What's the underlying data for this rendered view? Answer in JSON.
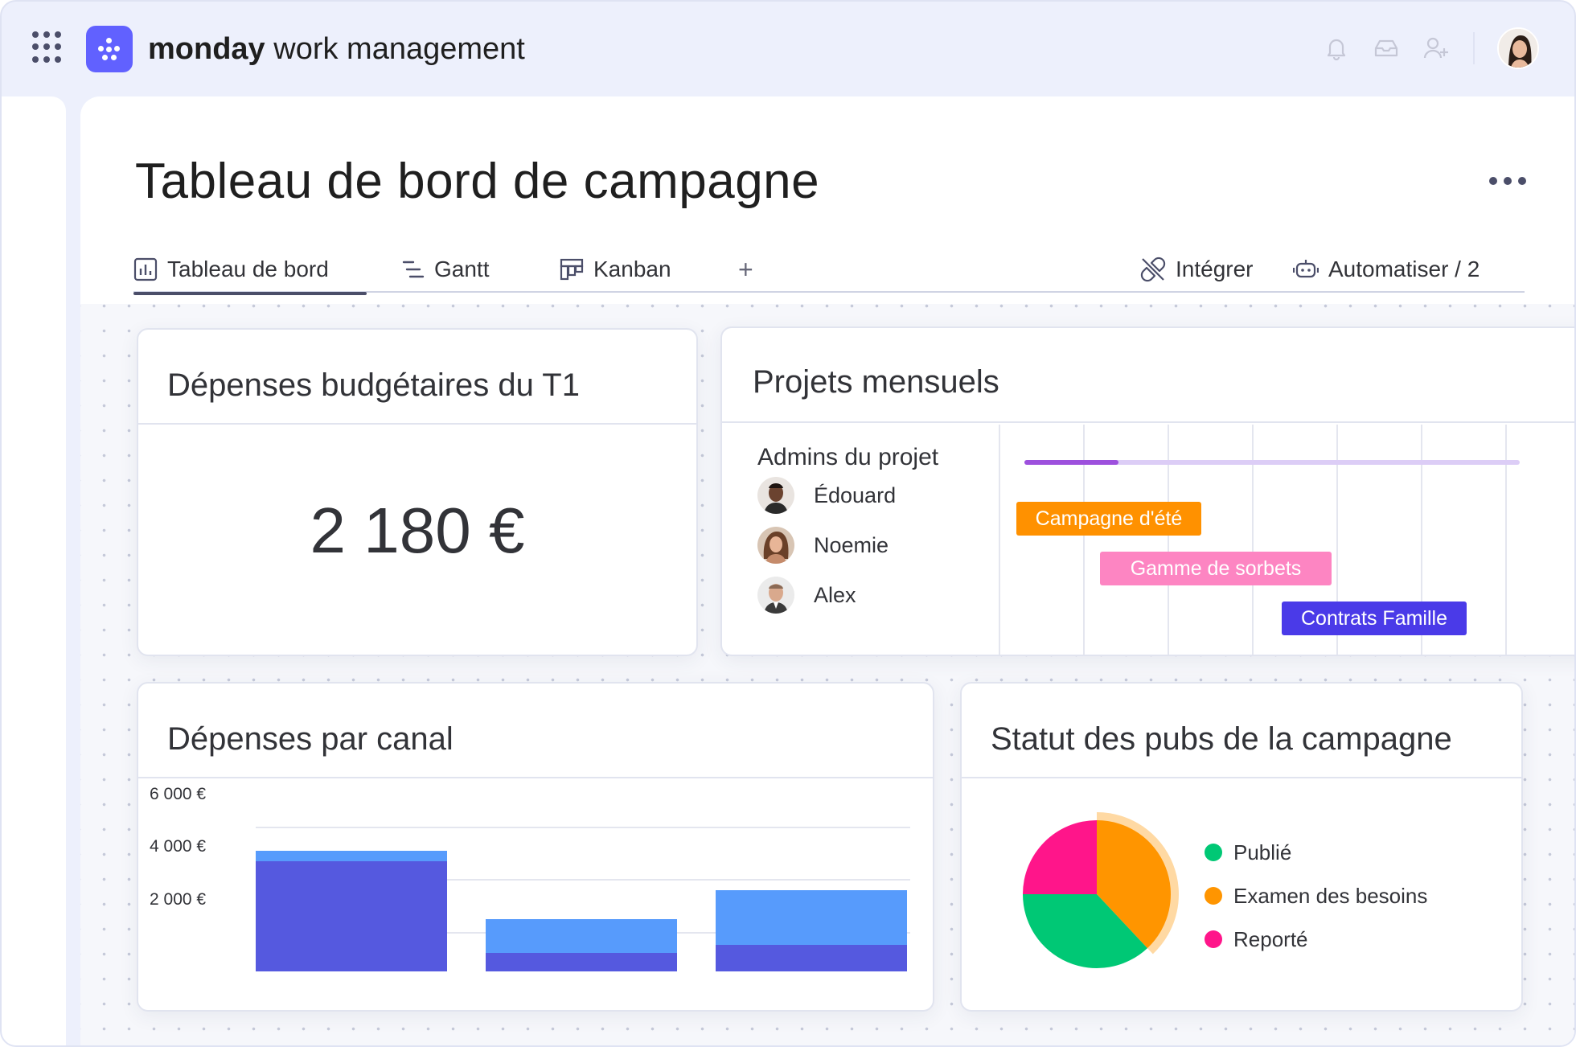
{
  "app": {
    "brand_bold": "monday",
    "brand_rest": " work management"
  },
  "topbar": {
    "icons": [
      "bell-icon",
      "inbox-icon",
      "invite-members-icon"
    ],
    "avatar": "user-avatar"
  },
  "page": {
    "title": "Tableau de bord de campagne"
  },
  "tabs": [
    {
      "label": "Tableau de bord",
      "icon": "dashboard-icon",
      "active": true
    },
    {
      "label": "Gantt",
      "icon": "gantt-icon",
      "active": false
    },
    {
      "label": "Kanban",
      "icon": "kanban-icon",
      "active": false
    }
  ],
  "tab_add": "+",
  "actions": {
    "integrate": "Intégrer",
    "automate": "Automatiser / 2"
  },
  "widgets": {
    "budget": {
      "title": "Dépenses budgétaires du T1",
      "value": "2 180 €"
    },
    "projects": {
      "title": "Projets mensuels",
      "admins_label": "Admins du projet",
      "people": [
        {
          "name": "Édouard"
        },
        {
          "name": "Noemie"
        },
        {
          "name": "Alex"
        }
      ],
      "timeline_progress": 0.19,
      "bars": [
        {
          "label": "Campagne d'été",
          "color": "#ff9100"
        },
        {
          "label": "Gamme de sorbets",
          "color": "#fd85c2"
        },
        {
          "label": "Contrats Famille",
          "color": "#4a3ae8"
        }
      ]
    },
    "spend": {
      "title": "Dépenses par canal",
      "chart_data": {
        "type": "bar",
        "stacked": true,
        "y_ticks": [
          "6 000 €",
          "4 000 €",
          "2 000 €"
        ],
        "ylim": [
          0,
          6000
        ],
        "categories": [
          "",
          "",
          ""
        ],
        "series": [
          {
            "color": "#5559df",
            "values": [
              4200,
              700,
              1000
            ]
          },
          {
            "color": "#579bfc",
            "values": [
              400,
              1300,
              2100
            ]
          }
        ],
        "grid": true
      }
    },
    "status": {
      "title": "Statut des pubs de la campagne",
      "chart_data": {
        "type": "pie",
        "slices": [
          {
            "label": "Publié",
            "value": 37,
            "color": "#00c875"
          },
          {
            "label": "Examen des besoins",
            "value": 38,
            "color": "#ff9500"
          },
          {
            "label": "Reporté",
            "value": 25,
            "color": "#ff158a"
          }
        ]
      }
    }
  }
}
